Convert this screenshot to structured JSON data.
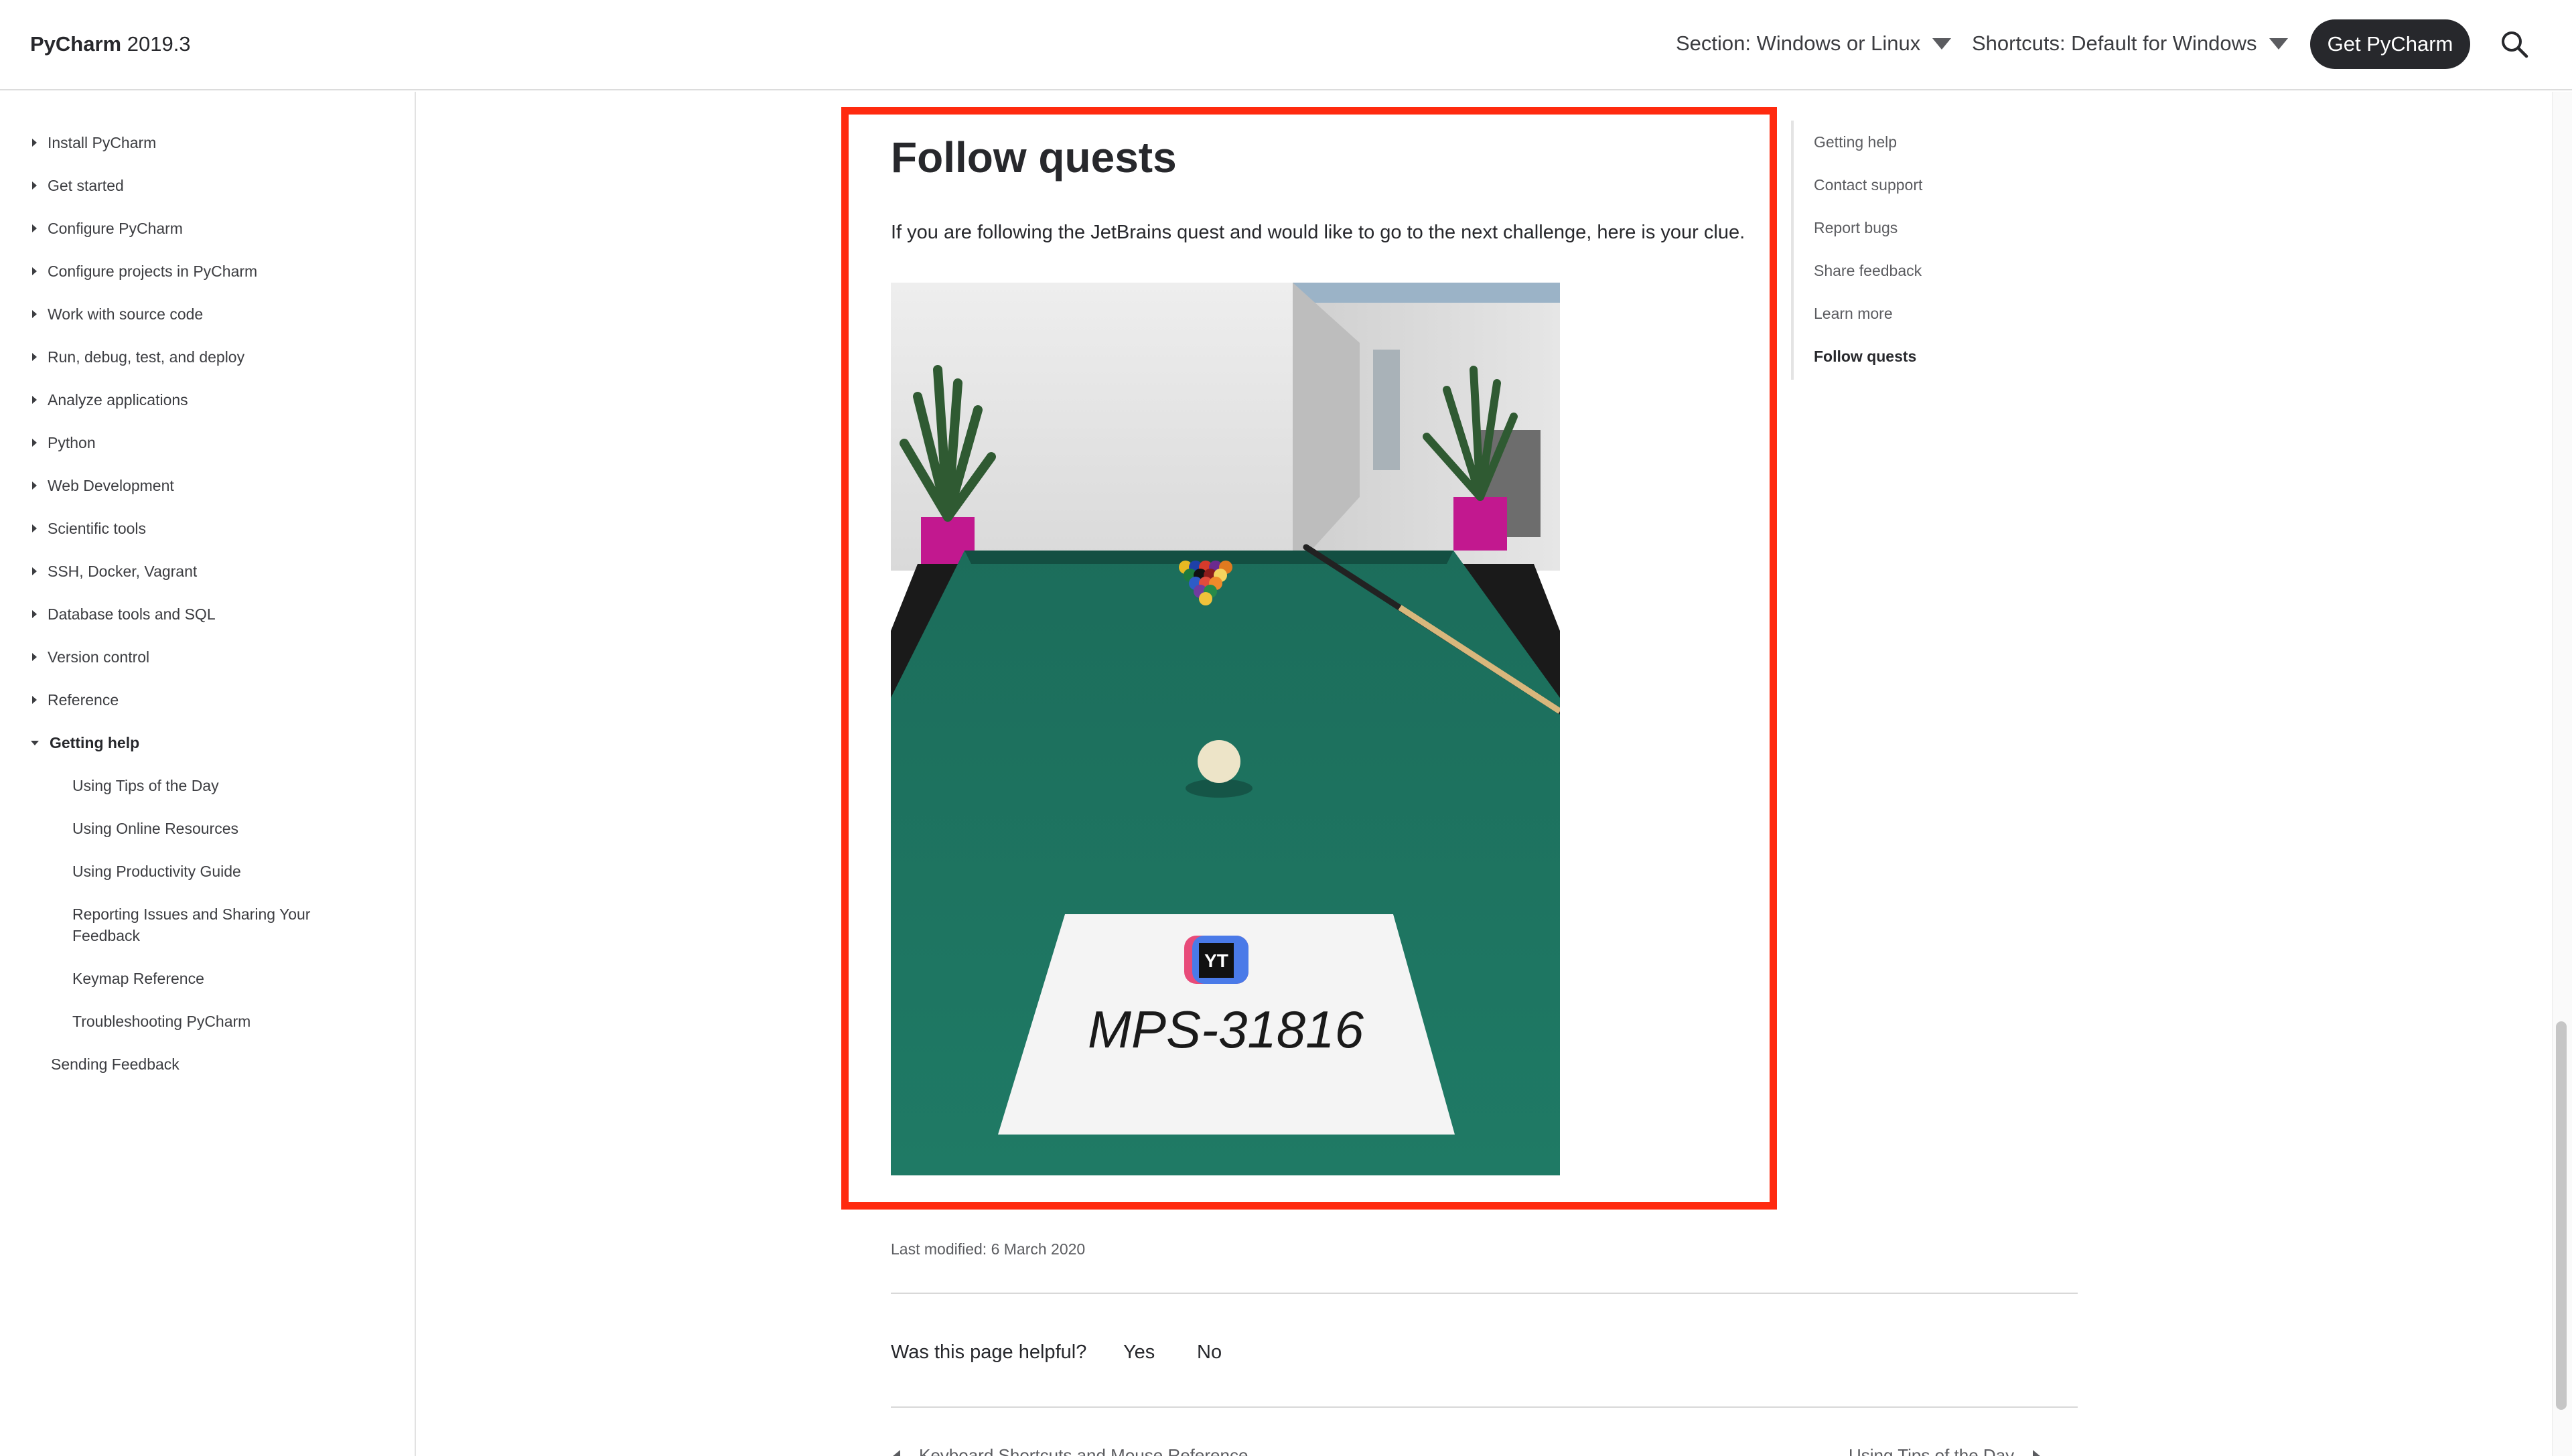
{
  "header": {
    "product": "PyCharm",
    "version": "2019.3",
    "section_select": "Section: Windows or Linux",
    "shortcuts_select": "Shortcuts: Default for Windows",
    "cta": "Get PyCharm",
    "search_icon": "search-icon"
  },
  "nav": {
    "items": [
      {
        "label": "Install PyCharm"
      },
      {
        "label": "Get started"
      },
      {
        "label": "Configure PyCharm"
      },
      {
        "label": "Configure projects in PyCharm"
      },
      {
        "label": "Work with source code"
      },
      {
        "label": "Run, debug, test, and deploy"
      },
      {
        "label": "Analyze applications"
      },
      {
        "label": "Python"
      },
      {
        "label": "Web Development"
      },
      {
        "label": "Scientific tools"
      },
      {
        "label": "SSH, Docker, Vagrant"
      },
      {
        "label": "Database tools and SQL"
      },
      {
        "label": "Version control"
      },
      {
        "label": "Reference"
      },
      {
        "label": "Getting help"
      }
    ],
    "sub_items": [
      {
        "label": "Using Tips of the Day"
      },
      {
        "label": "Using Online Resources"
      },
      {
        "label": "Using Productivity Guide"
      },
      {
        "label": "Reporting Issues and Sharing Your Feedback"
      },
      {
        "label": "Keymap Reference"
      },
      {
        "label": "Troubleshooting PyCharm"
      }
    ],
    "sending_feedback": "Sending Feedback"
  },
  "main": {
    "title": "Follow quests",
    "intro": "If you are following the JetBrains quest and would like to go to the next challenge, here is your clue.",
    "photo_sign_text": "MPS-31816",
    "photo_logo_text": "YT",
    "last_modified": "Last modified: 6 March 2020",
    "helpful_question": "Was this page helpful?",
    "yes": "Yes",
    "no": "No",
    "prev_link": "Keyboard Shortcuts and Mouse Reference",
    "next_link": "Using Tips of the Day"
  },
  "toc": {
    "items": [
      {
        "label": "Getting help"
      },
      {
        "label": "Contact support"
      },
      {
        "label": "Report bugs"
      },
      {
        "label": "Share feedback"
      },
      {
        "label": "Learn more"
      },
      {
        "label": "Follow quests"
      }
    ],
    "active": "Follow quests"
  },
  "colors": {
    "highlight_frame": "#ff2a0f",
    "cta_bg": "#27282c",
    "felt": "#1f7a65"
  }
}
